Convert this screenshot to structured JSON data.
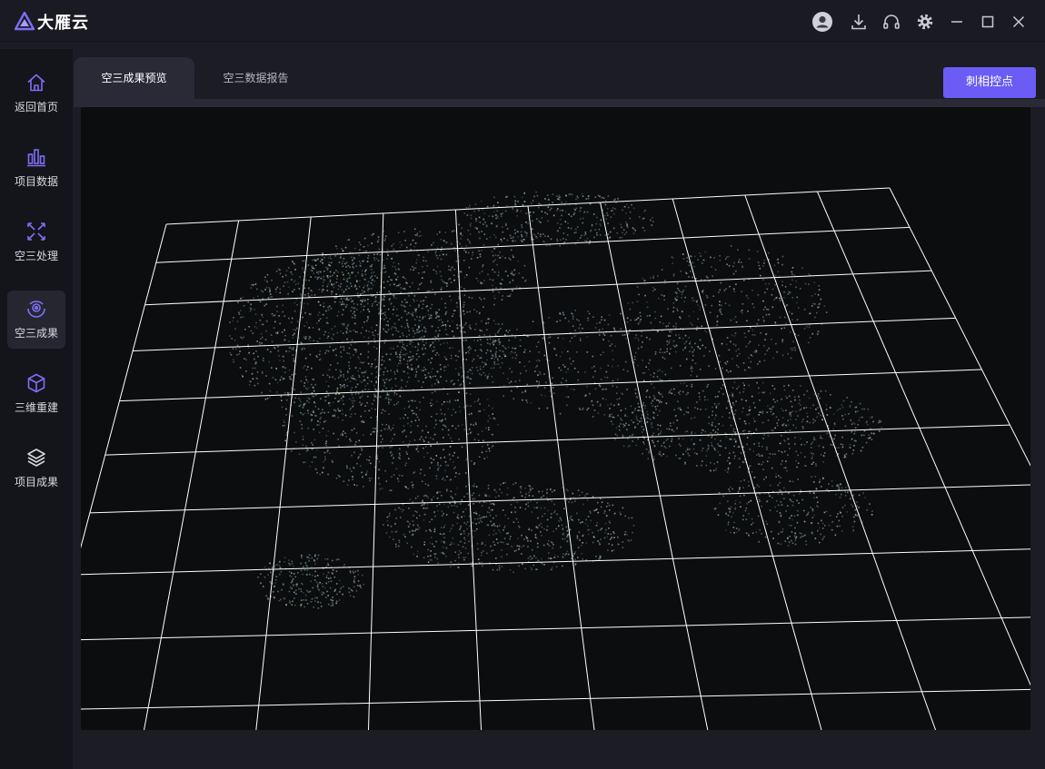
{
  "app": {
    "name": "大雁云"
  },
  "titlebar": {
    "icons": [
      "user-icon",
      "download-icon",
      "headset-icon",
      "gear-icon",
      "minimize-icon",
      "maximize-icon",
      "close-icon"
    ]
  },
  "sidebar": {
    "items": [
      {
        "label": "返回首页",
        "icon": "home-icon",
        "active": false
      },
      {
        "label": "项目数据",
        "icon": "bar-chart-icon",
        "active": false
      },
      {
        "label": "空三处理",
        "icon": "process-icon",
        "active": false
      },
      {
        "label": "空三成果",
        "icon": "result-icon",
        "active": true
      },
      {
        "label": "三维重建",
        "icon": "cube-icon",
        "active": false
      },
      {
        "label": "项目成果",
        "icon": "layers-icon",
        "active": false
      }
    ]
  },
  "tabs": [
    {
      "label": "空三成果预览",
      "active": true
    },
    {
      "label": "空三数据报告",
      "active": false
    }
  ],
  "actions": {
    "primary_label": "刺相控点"
  },
  "colors": {
    "accent": "#6a5cf5",
    "background": "#1c1c25",
    "viewer_bg": "#0b0d0f",
    "grid_line": "#ffffff"
  }
}
